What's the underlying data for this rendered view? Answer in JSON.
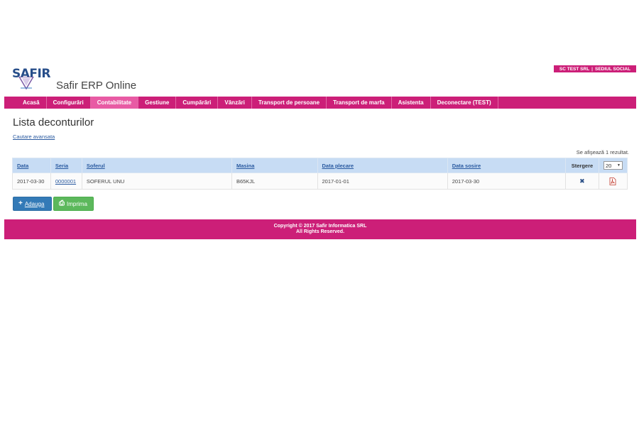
{
  "company": {
    "name": "SC TEST SRL",
    "separator": "|",
    "location": "SEDIUL SOCIAL"
  },
  "header": {
    "logo_text": "SAFIR",
    "app_title": "Safir ERP Online"
  },
  "nav": {
    "items": [
      {
        "label": "Acasă",
        "active": false
      },
      {
        "label": "Configurări",
        "active": false
      },
      {
        "label": "Contabilitate",
        "active": true
      },
      {
        "label": "Gestiune",
        "active": false
      },
      {
        "label": "Cumpărări",
        "active": false
      },
      {
        "label": "Vânzări",
        "active": false
      },
      {
        "label": "Transport de persoane",
        "active": false
      },
      {
        "label": "Transport de marfa",
        "active": false
      },
      {
        "label": "Asistenta",
        "active": false
      },
      {
        "label": "Deconectare (TEST)",
        "active": false
      }
    ]
  },
  "page": {
    "title": "Lista deconturilor",
    "advanced_search": "Cautare avansata",
    "result_count": "Se afişează 1 rezultat."
  },
  "table": {
    "headers": {
      "data": "Data",
      "seria": "Seria",
      "soferul": "Soferul",
      "masina": "Masina",
      "data_plecare": "Data plecare",
      "data_sosire": "Data sosire",
      "stergere": "Stergere"
    },
    "page_size": "20",
    "rows": [
      {
        "data": "2017-03-30",
        "seria": "0000001",
        "soferul": "SOFERUL UNU",
        "masina": "B65KJL",
        "data_plecare": "2017-01-01",
        "data_sosire": "2017-03-30",
        "delete_icon": "✖"
      }
    ]
  },
  "buttons": {
    "add": "Adauga",
    "add_icon": "+",
    "print": "Imprima",
    "print_icon": "⎙"
  },
  "footer": {
    "line1": "Copyright © 2017 Safir Informatica SRL",
    "line2": "All Rights Reserved."
  },
  "colors": {
    "brand": "#cc1f78",
    "nav_active": "#e85ba4",
    "table_header": "#c7dcf4",
    "link": "#2a5aa0",
    "add_button": "#337ab7",
    "print_button": "#5cb85c"
  }
}
